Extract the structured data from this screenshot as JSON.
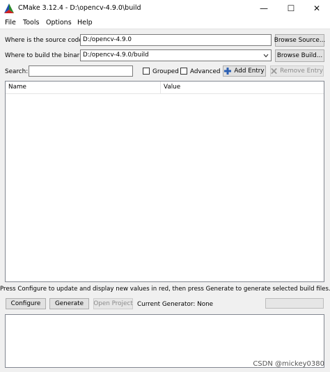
{
  "window": {
    "title": "CMake 3.12.4 - D:\\opencv-4.9.0\\build",
    "minimize_glyph": "—",
    "maximize_glyph": "☐",
    "close_glyph": "✕"
  },
  "menu": [
    "File",
    "Tools",
    "Options",
    "Help"
  ],
  "source": {
    "label": "Where is the source code:",
    "value": "D:/opencv-4.9.0",
    "browse_label": "Browse Source..."
  },
  "build": {
    "label": "Where to build the binaries:",
    "value": "D:/opencv-4.9.0/build",
    "browse_label": "Browse Build..."
  },
  "search": {
    "label": "Search:",
    "value": "",
    "grouped_label": "Grouped",
    "grouped_checked": false,
    "advanced_label": "Advanced",
    "advanced_checked": false,
    "add_entry_label": "Add Entry",
    "remove_entry_label": "Remove Entry"
  },
  "table": {
    "columns": [
      "Name",
      "Value"
    ]
  },
  "hint": "Press Configure to update and display new values in red, then press Generate to generate selected build files.",
  "actions": {
    "configure_label": "Configure",
    "generate_label": "Generate",
    "open_project_label": "Open Project",
    "current_generator": "Current Generator: None"
  },
  "watermark": "CSDN @mickey0380",
  "colors": {
    "add_icon": "#2b5fb3",
    "remove_icon": "#9a9a9a"
  }
}
